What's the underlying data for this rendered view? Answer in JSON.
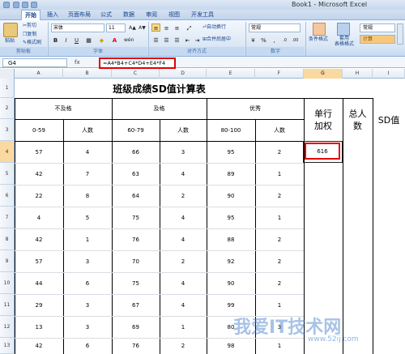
{
  "window": {
    "title": "Book1 - Microsoft Excel"
  },
  "ribbon": {
    "tabs": [
      "开始",
      "插入",
      "页面布局",
      "公式",
      "数据",
      "审阅",
      "视图",
      "开发工具"
    ],
    "active_tab": "开始",
    "clipboard": {
      "paste": "粘贴",
      "cut": "剪切",
      "copy": "复制",
      "format_painter": "格式刷",
      "group": "剪贴板"
    },
    "font": {
      "name": "宋体",
      "size": "11",
      "bold": "B",
      "italic": "I",
      "underline": "U",
      "group": "字体"
    },
    "alignment": {
      "wrap_text": "自动换行",
      "merge_center": "合并后居中",
      "group": "对齐方式"
    },
    "number": {
      "format": "常规",
      "group": "数字"
    },
    "styles": {
      "conditional_format": "条件格式",
      "table_format": "套用\n表格格式",
      "style_normal": "常规",
      "style_calc": "计算"
    }
  },
  "formula_bar": {
    "name_box": "G4",
    "fx": "fx",
    "formula": "=A4*B4+C4*D4+E4*F4"
  },
  "columns": [
    "A",
    "B",
    "C",
    "D",
    "E",
    "F",
    "G",
    "H",
    "I"
  ],
  "selected_column": "G",
  "rows": [
    "1",
    "2",
    "3",
    "4",
    "5",
    "6",
    "7",
    "8",
    "9",
    "10",
    "11",
    "12",
    "13"
  ],
  "selected_row": "4",
  "sheet": {
    "title": "班级成绩SD值计算表",
    "groups": [
      "不及格",
      "及格",
      "优秀"
    ],
    "ranges": [
      "0-59",
      "60-79",
      "80-100"
    ],
    "count_label": "人数",
    "weighted": "单行\n加权",
    "total": "总人\n数",
    "sd": "SD值",
    "data": [
      [
        "57",
        "4",
        "66",
        "3",
        "95",
        "2"
      ],
      [
        "42",
        "7",
        "63",
        "4",
        "89",
        "1"
      ],
      [
        "22",
        "8",
        "64",
        "2",
        "90",
        "2"
      ],
      [
        "4",
        "5",
        "75",
        "4",
        "95",
        "1"
      ],
      [
        "42",
        "1",
        "76",
        "4",
        "88",
        "2"
      ],
      [
        "57",
        "3",
        "70",
        "2",
        "92",
        "2"
      ],
      [
        "44",
        "6",
        "75",
        "4",
        "90",
        "2"
      ],
      [
        "29",
        "3",
        "67",
        "4",
        "99",
        "1"
      ],
      [
        "13",
        "3",
        "69",
        "1",
        "80",
        "3"
      ],
      [
        "42",
        "6",
        "76",
        "2",
        "98",
        "1"
      ]
    ],
    "g4_value": "616"
  },
  "watermark": {
    "text": "我爱IT技术网",
    "url": "www.52ij.com"
  }
}
